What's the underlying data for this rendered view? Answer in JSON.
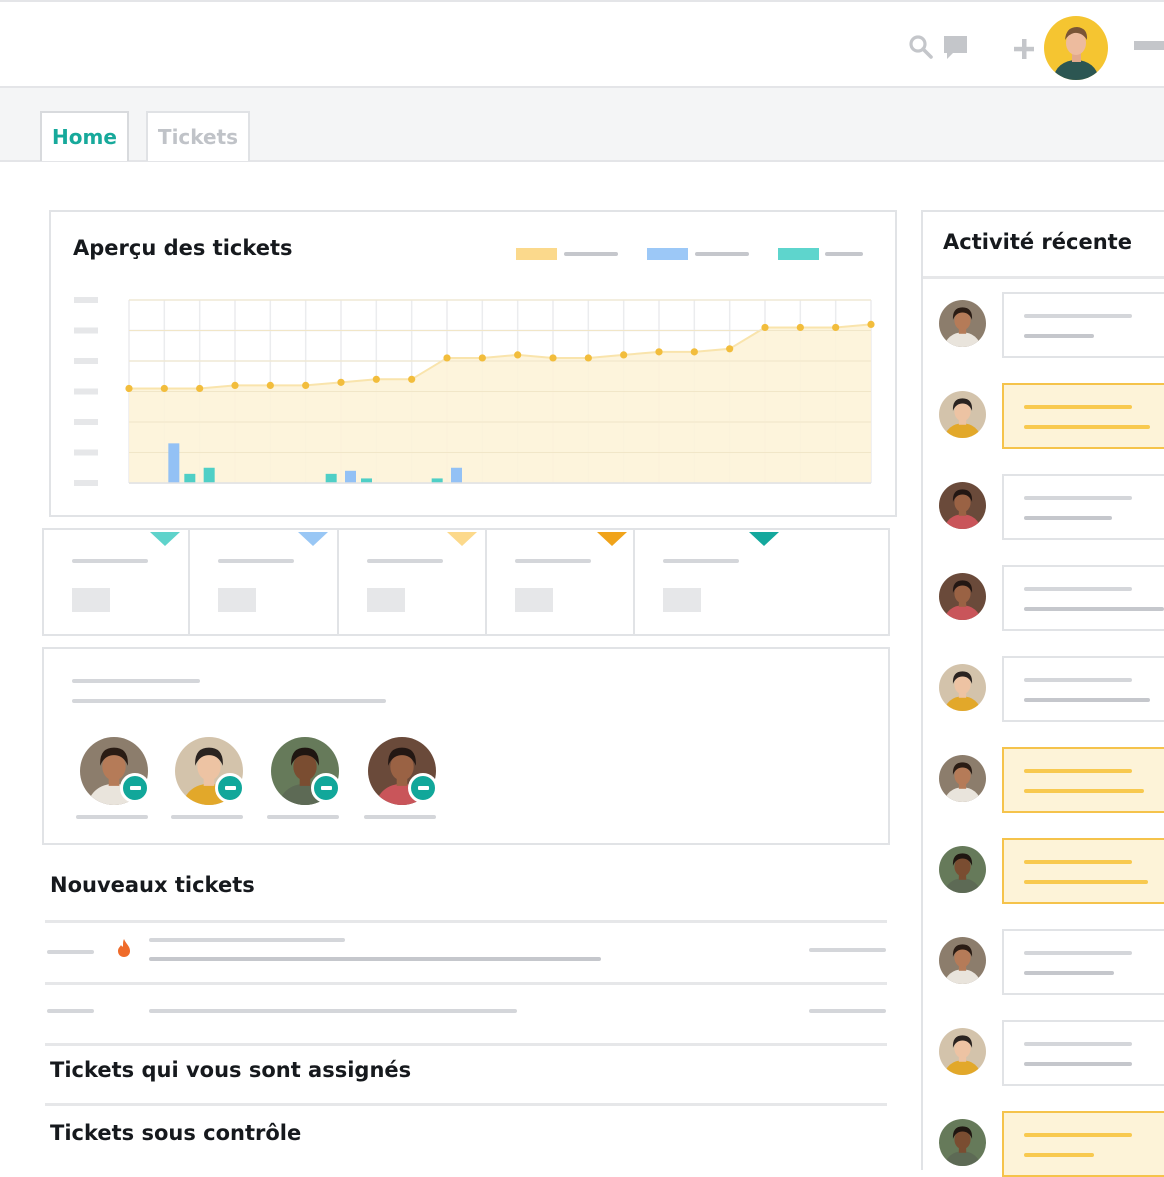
{
  "header": {
    "icons": [
      "search-icon",
      "chat-icon",
      "plus-icon",
      "menu-icon"
    ]
  },
  "tabs": [
    {
      "label": "Home",
      "active": true
    },
    {
      "label": "Tickets",
      "active": false
    }
  ],
  "overview": {
    "title": "Aperçu des tickets",
    "legend_colors": [
      "#fbd98c",
      "#9cc8f7",
      "#5ed5cd"
    ]
  },
  "chart_data": {
    "type": "line",
    "x": [
      1,
      2,
      3,
      4,
      5,
      6,
      7,
      8,
      9,
      10,
      11,
      12,
      13,
      14,
      15,
      16,
      17,
      18,
      19,
      20,
      21,
      22
    ],
    "series": [
      {
        "type": "area",
        "color": "#f2bd3c",
        "values": [
          3.1,
          3.1,
          3.1,
          3.2,
          3.2,
          3.2,
          3.3,
          3.4,
          3.4,
          4.1,
          4.1,
          4.2,
          4.1,
          4.1,
          4.2,
          4.3,
          4.3,
          4.4,
          5.1,
          5.1,
          5.1,
          5.2
        ]
      },
      {
        "type": "bar",
        "color": "#93c1f5",
        "values": [
          0,
          1.3,
          0,
          0,
          0,
          0,
          0.4,
          0,
          0,
          0.5,
          0,
          0,
          0,
          0,
          0,
          0,
          0,
          0,
          0,
          0,
          0,
          0
        ]
      },
      {
        "type": "bar",
        "color": "#4fcfc6",
        "values": [
          0,
          0.3,
          0.5,
          0,
          0,
          0.3,
          0.15,
          0,
          0.15,
          0,
          0,
          0,
          0,
          0,
          0,
          0,
          0,
          0,
          0,
          0,
          0,
          0
        ]
      }
    ],
    "ylim": [
      0,
      6
    ],
    "grid": true
  },
  "status_colors": [
    "#5fd3cb",
    "#99c7f5",
    "#fcd98b",
    "#f0a31a",
    "#14a89d"
  ],
  "agents_card": {
    "agents": [
      "agent-1",
      "agent-2",
      "agent-3",
      "agent-4"
    ]
  },
  "sections": {
    "new_tickets": "Nouveaux tickets",
    "assigned": "Tickets qui vous sont assignés",
    "monitored": "Tickets sous contrôle"
  },
  "activity": {
    "title": "Activité récente",
    "items": [
      {
        "highlight": false
      },
      {
        "highlight": true
      },
      {
        "highlight": false
      },
      {
        "highlight": false
      },
      {
        "highlight": false
      },
      {
        "highlight": true
      },
      {
        "highlight": true
      },
      {
        "highlight": false
      },
      {
        "highlight": false
      },
      {
        "highlight": true
      }
    ]
  },
  "priority_icon": "flame-icon",
  "colors": {
    "accent": "#17a99b",
    "highlight_bg": "#fdf3d8",
    "highlight_border": "#f5c34b"
  }
}
